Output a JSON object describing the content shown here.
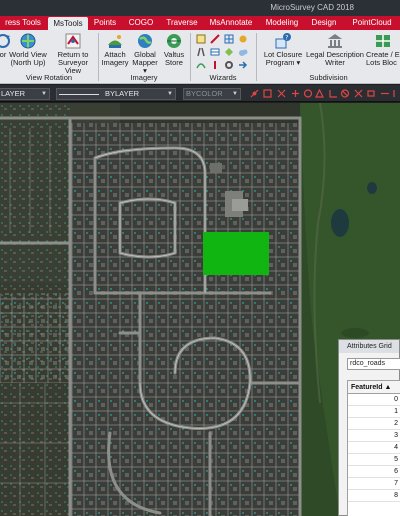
{
  "app": {
    "title": "MicroSurvey CAD 2018"
  },
  "tabs": [
    {
      "label": "ress Tools",
      "active": false
    },
    {
      "label": "MsTools",
      "active": true
    },
    {
      "label": "Points",
      "active": false
    },
    {
      "label": "COGO",
      "active": false
    },
    {
      "label": "Traverse",
      "active": false
    },
    {
      "label": "MsAnnotate",
      "active": false
    },
    {
      "label": "Modeling",
      "active": false
    },
    {
      "label": "Design",
      "active": false
    },
    {
      "label": "PointCloud",
      "active": false
    }
  ],
  "ribbon": {
    "view_rotation": {
      "label": "View Rotation",
      "buttons": [
        {
          "line1": "or",
          "line2": "",
          "icon": "rotate-icon"
        },
        {
          "line1": "World View",
          "line2": "(North Up)",
          "icon": "globe-north-icon"
        },
        {
          "line1": "Return to",
          "line2": "Surveyor View",
          "icon": "return-view-icon"
        }
      ]
    },
    "imagery": {
      "label": "Imagery",
      "buttons": [
        {
          "line1": "Attach",
          "line2": "Imagery",
          "icon": "attach-imagery-icon"
        },
        {
          "line1": "Global",
          "line2": "Mapper ▾",
          "icon": "global-mapper-icon"
        },
        {
          "line1": "Valtus",
          "line2": "Store",
          "icon": "valtus-store-icon"
        }
      ]
    },
    "wizards": {
      "label": "Wizards"
    },
    "subdivision": {
      "label": "Subdivision",
      "buttons": [
        {
          "line1": "Lot Closure",
          "line2": "Program ▾",
          "icon": "lot-closure-icon"
        },
        {
          "line1": "Legal Description",
          "line2": "Writer",
          "icon": "legal-description-icon"
        },
        {
          "line1": "Create / E",
          "line2": "Lots  Bloc",
          "icon": "create-lots-icon"
        }
      ]
    }
  },
  "propbar": {
    "layer": "LAYER",
    "linetype": "BYLAYER",
    "color": "BYCOLOR"
  },
  "attributes": {
    "title": "Attributes Grid",
    "layer_value": "rdco_roads",
    "column": "FeatureId ▲",
    "rows": [
      "0",
      "1",
      "2",
      "3",
      "4",
      "5",
      "6",
      "7",
      "8"
    ]
  },
  "colors": {
    "tab_strip": "#c8102e",
    "ribbon_bg": "#e6e8eb",
    "selection_fill": "#11b511",
    "parcel_lines": "#cfd3d6",
    "point_markers": "#2fd0d8"
  }
}
